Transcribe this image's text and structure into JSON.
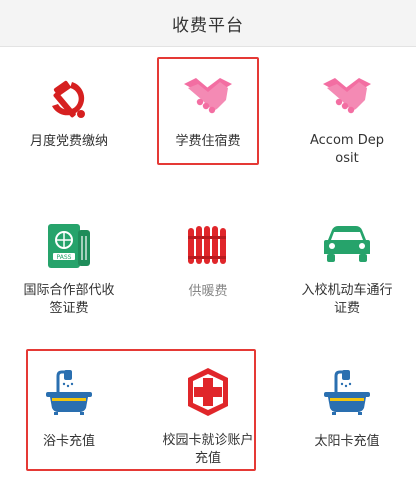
{
  "header": {
    "title": "收费平台"
  },
  "tiles": [
    {
      "label": "月度党费缴纳",
      "icon": "hammer-sickle-icon"
    },
    {
      "label": "学费住宿费",
      "icon": "handshake-icon"
    },
    {
      "label": "Accom Deposit",
      "icon": "handshake-icon"
    },
    {
      "label": "国际合作部代收签证费",
      "icon": "passport-icon"
    },
    {
      "label": "供暖费",
      "icon": "radiator-icon"
    },
    {
      "label": "入校机动车通行证费",
      "icon": "car-icon"
    },
    {
      "label": "浴卡充值",
      "icon": "bathtub-icon"
    },
    {
      "label": "校园卡就诊账户充值",
      "icon": "medical-cross-icon"
    },
    {
      "label": "太阳卡充值",
      "icon": "bathtub-icon"
    }
  ],
  "colors": {
    "accent": "#e53935",
    "pink": "#f36ea2",
    "green": "#26a36b",
    "blue": "#2a6fb0",
    "red": "#e0262a"
  }
}
